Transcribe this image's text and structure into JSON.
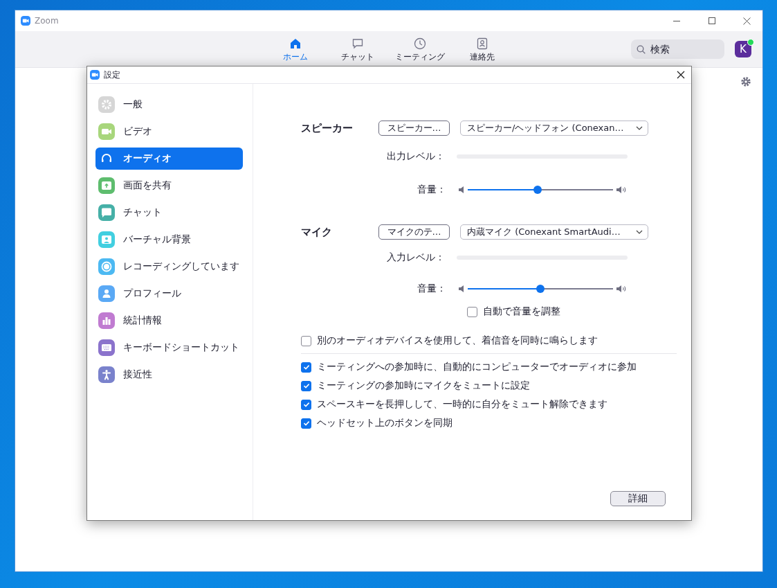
{
  "window": {
    "title": "Zoom"
  },
  "nav_tabs": [
    {
      "label": "ホーム",
      "kind": "home",
      "selected": true
    },
    {
      "label": "チャット",
      "kind": "chat",
      "selected": false
    },
    {
      "label": "ミーティング",
      "kind": "meeting",
      "selected": false
    },
    {
      "label": "連絡先",
      "kind": "contacts",
      "selected": false
    }
  ],
  "search": {
    "placeholder": "検索"
  },
  "avatar": {
    "initial": "K"
  },
  "settings": {
    "title": "設定",
    "sidebar": [
      {
        "label": "一般",
        "kind": "general",
        "color": "#d6d6d6",
        "selected": false
      },
      {
        "label": "ビデオ",
        "kind": "video",
        "color": "#a8d67c",
        "selected": false
      },
      {
        "label": "オーディオ",
        "kind": "audio",
        "color": "#0e72ed",
        "selected": true
      },
      {
        "label": "画面を共有",
        "kind": "share",
        "color": "#5ebd6e",
        "selected": false
      },
      {
        "label": "チャット",
        "kind": "chat",
        "color": "#46b0a7",
        "selected": false
      },
      {
        "label": "バーチャル背景",
        "kind": "background",
        "color": "#42cfe0",
        "selected": false
      },
      {
        "label": "レコーディングしています",
        "kind": "recording",
        "color": "#4cb9f2",
        "selected": false
      },
      {
        "label": "プロフィール",
        "kind": "profile",
        "color": "#5aa9f5",
        "selected": false
      },
      {
        "label": "統計情報",
        "kind": "statistics",
        "color": "#c07bd1",
        "selected": false
      },
      {
        "label": "キーボードショートカット",
        "kind": "keyboard",
        "color": "#8b73cc",
        "selected": false
      },
      {
        "label": "接近性",
        "kind": "accessibility",
        "color": "#7a82cc",
        "selected": false
      }
    ],
    "speaker": {
      "heading": "スピーカー",
      "test_button": "スピーカー…",
      "device": "スピーカー/ヘッドフォン (Conexan…",
      "meter_label": "出力レベル：",
      "meter": {
        "level": 0
      },
      "volume_label": "音量：",
      "volume": {
        "level": 0.48
      }
    },
    "microphone": {
      "heading": "マイク",
      "test_button": "マイクのテ…",
      "device": "内蔵マイク (Conexant SmartAudi…",
      "meter_label": "入力レベル：",
      "meter": {
        "level": 0
      },
      "volume_label": "音量：",
      "volume": {
        "level": 0.5
      },
      "auto_adjust": {
        "label": "自動で音量を調整",
        "checked": false
      }
    },
    "ring_option": {
      "label": "別のオーディオデバイスを使用して、着信音を同時に鳴らします",
      "checked": false
    },
    "options": [
      {
        "label": "ミーティングへの参加時に、自動的にコンピューターでオーディオに参加",
        "checked": true
      },
      {
        "label": "ミーティングの参加時にマイクをミュートに設定",
        "checked": true
      },
      {
        "label": "スペースキーを長押しして、一時的に自分をミュート解除できます",
        "checked": true
      },
      {
        "label": "ヘッドセット上のボタンを同期",
        "checked": true
      }
    ],
    "advanced_button": "詳細"
  }
}
